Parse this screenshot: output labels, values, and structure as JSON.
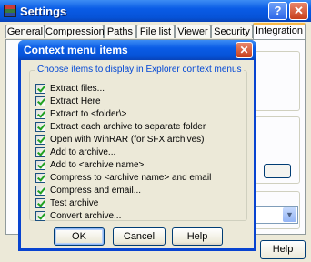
{
  "window": {
    "title": "Settings",
    "help_glyph": "?",
    "close_glyph": "✕"
  },
  "tabs": [
    "General",
    "Compression",
    "Paths",
    "File list",
    "Viewer",
    "Security",
    "Integration"
  ],
  "active_tab": "Integration",
  "main_help_label": "Help",
  "background_dropdown_arrow": "▼",
  "dialog": {
    "title": "Context menu items",
    "close_glyph": "✕",
    "group_label": "Choose items to display in Explorer context menus",
    "items": [
      {
        "label": "Extract files...",
        "checked": true
      },
      {
        "label": "Extract Here",
        "checked": true
      },
      {
        "label": "Extract to <folder\\>",
        "checked": true
      },
      {
        "label": "Extract each archive to separate folder",
        "checked": true
      },
      {
        "label": "Open with WinRAR (for SFX archives)",
        "checked": true
      },
      {
        "label": "Add to archive...",
        "checked": true
      },
      {
        "label": "Add to <archive name>",
        "checked": true
      },
      {
        "label": "Compress to <archive name> and email",
        "checked": true
      },
      {
        "label": "Compress and email...",
        "checked": true
      },
      {
        "label": "Test archive",
        "checked": true
      },
      {
        "label": "Convert archive...",
        "checked": true
      }
    ],
    "buttons": {
      "ok": "OK",
      "cancel": "Cancel",
      "help": "Help"
    }
  }
}
